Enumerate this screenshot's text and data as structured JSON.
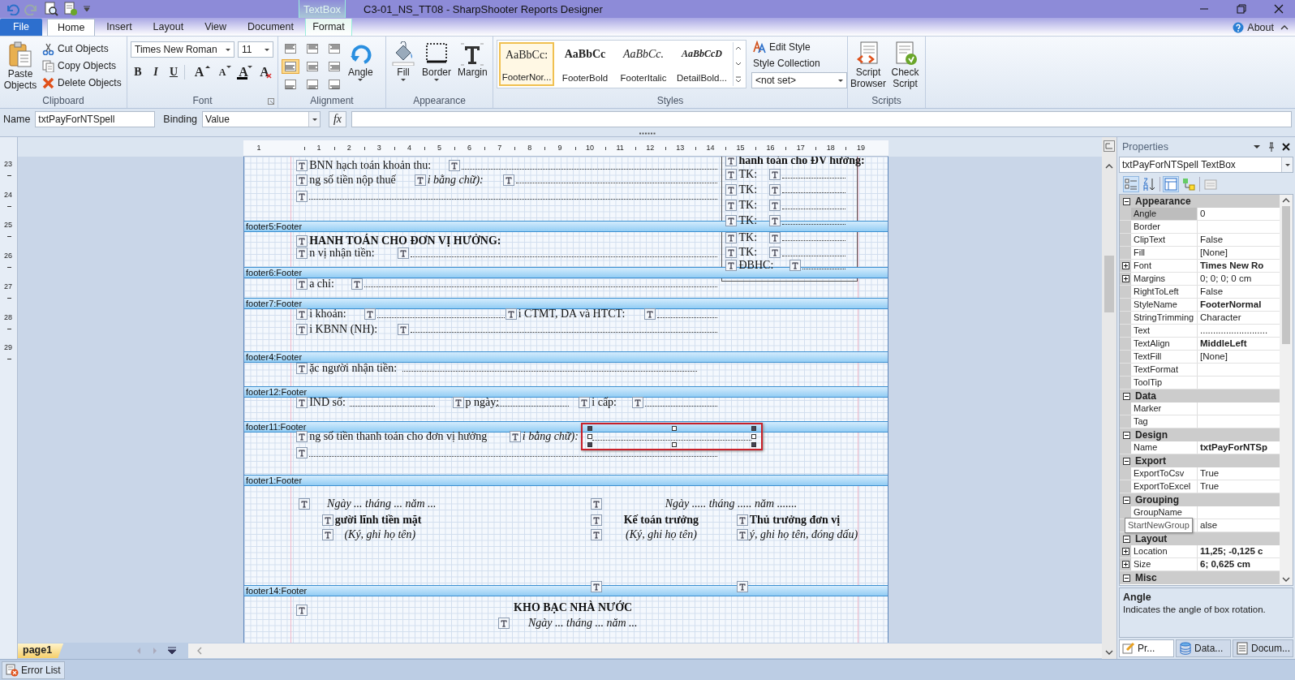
{
  "window": {
    "title": "C3-01_NS_TT08 - SharpShooter Reports Designer",
    "context_tab": "TextBox"
  },
  "tabs": [
    {
      "label": "File",
      "kind": "file",
      "selected": false
    },
    {
      "label": "Home",
      "kind": "tab",
      "selected": true
    },
    {
      "label": "Insert",
      "kind": "tab",
      "selected": false
    },
    {
      "label": "Layout",
      "kind": "tab",
      "selected": false
    },
    {
      "label": "View",
      "kind": "tab",
      "selected": false
    },
    {
      "label": "Document",
      "kind": "tab",
      "selected": false
    },
    {
      "label": "Format",
      "kind": "context",
      "selected": false
    }
  ],
  "help": {
    "label": "About"
  },
  "ribbon": {
    "clipboard": {
      "label": "Clipboard",
      "paste": "Paste Objects",
      "actions": [
        {
          "kind": "cut",
          "label": "Cut Objects"
        },
        {
          "kind": "copy",
          "label": "Copy Objects"
        },
        {
          "kind": "delete",
          "label": "Delete Objects"
        }
      ]
    },
    "font": {
      "label": "Font",
      "family": "Times New Roman",
      "size": "11",
      "styles": [
        {
          "kind": "bold",
          "glyph": "B"
        },
        {
          "kind": "italic",
          "glyph": "I"
        },
        {
          "kind": "underline",
          "glyph": "U"
        }
      ],
      "tools": [
        {
          "kind": "grow",
          "glyph": "A"
        },
        {
          "kind": "shrink",
          "glyph": "A"
        },
        {
          "kind": "color",
          "glyph": "A"
        },
        {
          "kind": "clear",
          "glyph": "A"
        }
      ]
    },
    "alignment": {
      "label": "Alignment",
      "angle": "Angle",
      "options": [
        {
          "selected": false
        },
        {
          "selected": false
        },
        {
          "selected": false
        },
        {
          "selected": true
        },
        {
          "selected": false
        },
        {
          "selected": false
        },
        {
          "selected": false
        },
        {
          "selected": false
        },
        {
          "selected": false
        }
      ]
    },
    "appearance": {
      "label": "Appearance",
      "buttons": [
        {
          "kind": "fill",
          "label": "Fill"
        },
        {
          "kind": "border",
          "label": "Border"
        },
        {
          "kind": "margin",
          "label": "Margin"
        }
      ]
    },
    "styles": {
      "label": "Styles",
      "edit": "Edit Style",
      "collection": "Style Collection",
      "collection_value": "<not set>",
      "gallery": [
        {
          "sample": "AaBbCc:",
          "label": "FooterNor...",
          "kind": "normal",
          "selected": true
        },
        {
          "sample": "AaBbCc",
          "label": "FooterBold",
          "kind": "bold",
          "selected": false
        },
        {
          "sample": "AaBbCc.",
          "label": "FooterItalic",
          "kind": "italic",
          "selected": false
        },
        {
          "sample": "AaBbCcD",
          "label": "DetailBold...",
          "kind": "bolditalic",
          "selected": false
        }
      ]
    },
    "scripts": {
      "label": "Scripts",
      "buttons": [
        {
          "kind": "browser",
          "label": "Script Browser"
        },
        {
          "kind": "check",
          "label": "Check Script"
        }
      ]
    }
  },
  "name_bar": {
    "name_label": "Name",
    "name": "txtPayForNTSpell",
    "binding_label": "Binding",
    "binding": "Value",
    "formula_button": "fx"
  },
  "ruler": {
    "horizontal": [
      "1",
      "1",
      "2",
      "3",
      "4",
      "5",
      "6",
      "7",
      "8",
      "9",
      "10",
      "11",
      "12",
      "13",
      "14",
      "15",
      "16",
      "17",
      "18",
      "19"
    ],
    "vertical": [
      "23",
      "24",
      "25",
      "26",
      "27",
      "28",
      "29"
    ]
  },
  "bands": [
    {
      "items": [
        {
          "kind": "bold",
          "text": "hanh toán cho ĐV hưởng:",
          "marker": true,
          "selected": false
        },
        {
          "kind": "text",
          "text": "BNN hạch toán khoản thu:",
          "marker": true,
          "selected": false
        },
        {
          "kind": "dots",
          "marker": true,
          "selected": false
        },
        {
          "kind": "text",
          "text": "ng số tiền nộp thuế",
          "marker": true,
          "selected": false
        },
        {
          "kind": "italic",
          "text": "i bằng chữ):",
          "marker": true,
          "selected": false
        },
        {
          "kind": "dots",
          "marker": true,
          "selected": false
        },
        {
          "kind": "dots",
          "marker": true,
          "selected": false
        },
        {
          "kind": "text",
          "text": "TK:",
          "marker": true,
          "selected": false
        },
        {
          "kind": "dots",
          "marker": true,
          "selected": false
        },
        {
          "kind": "text",
          "text": "TK:",
          "marker": true,
          "selected": false
        },
        {
          "kind": "dots",
          "marker": true,
          "selected": false
        },
        {
          "kind": "text",
          "text": "TK:",
          "marker": true,
          "selected": false
        },
        {
          "kind": "dots",
          "marker": true,
          "selected": false
        },
        {
          "kind": "text",
          "text": "TK:",
          "marker": true,
          "selected": false
        },
        {
          "kind": "dots",
          "marker": true,
          "selected": false
        },
        {
          "kind": "text",
          "text": "TK:",
          "marker": true,
          "selected": false
        },
        {
          "kind": "dots",
          "marker": true,
          "selected": false
        },
        {
          "kind": "text",
          "text": "TK:",
          "marker": true,
          "selected": false
        },
        {
          "kind": "dots",
          "marker": true,
          "selected": false
        },
        {
          "kind": "text",
          "text": "ĐBHC:",
          "marker": true,
          "selected": false
        },
        {
          "kind": "dots",
          "marker": true,
          "selected": false
        }
      ]
    },
    {
      "label": "footer5:Footer",
      "items": [
        {
          "kind": "bold",
          "text": "HANH TOÁN CHO ĐƠN VỊ HƯỞNG:",
          "marker": true,
          "selected": false
        },
        {
          "kind": "text",
          "text": "n vị nhận tiền:",
          "marker": true,
          "selected": false
        },
        {
          "kind": "dots",
          "marker": true,
          "selected": false
        }
      ]
    },
    {
      "label": "footer6:Footer",
      "items": [
        {
          "kind": "text",
          "text": "a chỉ:",
          "marker": true,
          "selected": false
        },
        {
          "kind": "dots",
          "marker": true,
          "selected": false
        }
      ]
    },
    {
      "label": "footer7:Footer",
      "items": [
        {
          "kind": "text",
          "text": "i khoản:",
          "marker": true,
          "selected": false
        },
        {
          "kind": "dots",
          "marker": true,
          "selected": false
        },
        {
          "kind": "text",
          "text": "i CTMT, DA và HTCT:",
          "marker": true,
          "selected": false
        },
        {
          "kind": "dots",
          "marker": true,
          "selected": false
        },
        {
          "kind": "text",
          "text": "i KBNN (NH):",
          "marker": true,
          "selected": false
        },
        {
          "kind": "dots",
          "marker": true,
          "selected": false
        }
      ]
    },
    {
      "label": "footer4:Footer",
      "items": [
        {
          "kind": "text",
          "text": "ặc người nhận tiền:",
          "marker": true,
          "selected": false
        },
        {
          "kind": "dots",
          "marker": false,
          "selected": false
        }
      ]
    },
    {
      "label": "footer12:Footer",
      "items": [
        {
          "kind": "text",
          "text": "IND số:",
          "marker": true,
          "selected": false
        },
        {
          "kind": "dots",
          "marker": false,
          "selected": false
        },
        {
          "kind": "text",
          "text": "p ngày:",
          "marker": true,
          "selected": false
        },
        {
          "kind": "dots",
          "marker": false,
          "selected": false
        },
        {
          "kind": "text",
          "text": "i cấp:",
          "marker": true,
          "selected": false
        },
        {
          "kind": "dots",
          "marker": true,
          "selected": false
        }
      ]
    },
    {
      "label": "footer11:Footer",
      "items": [
        {
          "kind": "text",
          "text": "ng số tiền thanh toán cho đơn vị hưởng",
          "marker": true,
          "selected": false
        },
        {
          "kind": "italic",
          "text": "i bằng chữ):",
          "marker": true,
          "selected": false
        },
        {
          "kind": "dots",
          "marker": false,
          "selected": true
        },
        {
          "kind": "dots",
          "marker": true,
          "selected": false
        }
      ]
    },
    {
      "label": "footer1:Footer",
      "items": [
        {
          "kind": "italic",
          "text": "Ngày ... tháng ... năm ...",
          "marker": true,
          "selected": false
        },
        {
          "kind": "bold",
          "text": "gười lĩnh tiền mặt",
          "marker": true,
          "selected": false
        },
        {
          "kind": "italic",
          "text": "(Ký, ghi họ tên)",
          "marker": true,
          "selected": false
        },
        {
          "kind": "italic",
          "text": "Ngày ..... tháng ..... năm .......",
          "marker": true,
          "selected": false
        },
        {
          "kind": "bold",
          "text": "Kế toán trưởng",
          "marker": true,
          "selected": false
        },
        {
          "kind": "italic",
          "text": "(Ký, ghi họ tên)",
          "marker": true,
          "selected": false
        },
        {
          "kind": "bold",
          "text": "Thủ trưởng đơn vị",
          "marker": true,
          "selected": false
        },
        {
          "kind": "italic",
          "text": "ý, ghi họ tên, đóng dấu)",
          "marker": true,
          "selected": false
        },
        {
          "kind": "empty",
          "marker": true,
          "selected": false
        },
        {
          "kind": "empty",
          "marker": true,
          "selected": false
        }
      ]
    },
    {
      "label": "footer14:Footer",
      "items": [
        {
          "kind": "empty",
          "marker": true,
          "selected": false
        },
        {
          "kind": "bold",
          "text": "KHO BẠC NHÀ NƯỚC",
          "marker": false,
          "selected": false
        },
        {
          "kind": "italic",
          "text": "Ngày ... tháng ... năm ...",
          "marker": true,
          "selected": false
        }
      ]
    }
  ],
  "page_tabs": [
    {
      "label": "page1",
      "selected": true
    }
  ],
  "error_list": "Error List",
  "properties": {
    "title": "Properties",
    "object": "txtPayForNTSpell TextBox",
    "description_title": "Angle",
    "description": "Indicates the angle of box rotation.",
    "tooltip": "StartNewGroup",
    "groups": [
      {
        "name": "Appearance",
        "expanded": true,
        "rows": [
          {
            "name": "Angle",
            "value": "0",
            "modified": false,
            "expandable": false,
            "selected": true
          },
          {
            "name": "Border",
            "expandable": false,
            "selected": false
          },
          {
            "name": "ClipText",
            "value": "False",
            "modified": false,
            "expandable": false,
            "selected": false
          },
          {
            "name": "Fill",
            "value": "[None]",
            "modified": false,
            "expandable": false,
            "selected": false
          },
          {
            "name": "Font",
            "value": "Times New Ro",
            "modified": true,
            "expandable": true,
            "selected": false
          },
          {
            "name": "Margins",
            "value": "0; 0; 0; 0 cm",
            "modified": false,
            "expandable": true,
            "selected": false
          },
          {
            "name": "RightToLeft",
            "value": "False",
            "modified": false,
            "expandable": false,
            "selected": false
          },
          {
            "name": "StyleName",
            "value": "FooterNormal",
            "modified": true,
            "expandable": false,
            "selected": false
          },
          {
            "name": "StringTrimming",
            "value": "Character",
            "modified": false,
            "expandable": false,
            "selected": false
          },
          {
            "name": "Text",
            "value": "..........................",
            "modified": false,
            "expandable": false,
            "selected": false
          },
          {
            "name": "TextAlign",
            "value": "MiddleLeft",
            "modified": true,
            "expandable": false,
            "selected": false
          },
          {
            "name": "TextFill",
            "value": "[None]",
            "modified": false,
            "expandable": false,
            "selected": false
          },
          {
            "name": "TextFormat",
            "expandable": false,
            "selected": false
          },
          {
            "name": "ToolTip",
            "expandable": false,
            "selected": false
          }
        ]
      },
      {
        "name": "Data",
        "expanded": true,
        "rows": [
          {
            "name": "Marker",
            "expandable": false,
            "selected": false
          },
          {
            "name": "Tag",
            "expandable": false,
            "selected": false
          }
        ]
      },
      {
        "name": "Design",
        "expanded": true,
        "rows": [
          {
            "name": "Name",
            "value": "txtPayForNTSp",
            "modified": true,
            "expandable": false,
            "selected": false
          }
        ]
      },
      {
        "name": "Export",
        "expanded": true,
        "rows": [
          {
            "name": "ExportToCsv",
            "value": "True",
            "modified": false,
            "expandable": false,
            "selected": false
          },
          {
            "name": "ExportToExcel",
            "value": "True",
            "modified": false,
            "expandable": false,
            "selected": false
          }
        ]
      },
      {
        "name": "Grouping",
        "expanded": true,
        "rows": [
          {
            "name": "GroupName",
            "expandable": false,
            "selected": false
          },
          {
            "value": "alse",
            "modified": false,
            "expandable": false,
            "selected": false
          }
        ]
      },
      {
        "name": "Layout",
        "expanded": true,
        "rows": [
          {
            "name": "Location",
            "value": "11,25; -0,125 c",
            "modified": true,
            "expandable": true,
            "selected": false
          },
          {
            "name": "Size",
            "value": "6; 0,625 cm",
            "modified": true,
            "expandable": true,
            "selected": false
          }
        ]
      },
      {
        "name": "Misc",
        "expanded": true
      }
    ],
    "tabs": [
      {
        "label": "Pr...",
        "kind": "props",
        "selected": true
      },
      {
        "label": "Data...",
        "kind": "data",
        "selected": false
      },
      {
        "label": "Docum...",
        "kind": "doc",
        "selected": false
      }
    ]
  }
}
